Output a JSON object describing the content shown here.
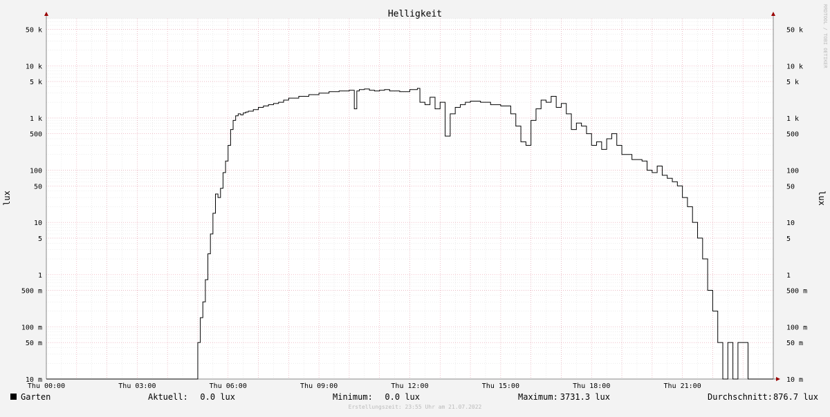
{
  "chart_data": {
    "type": "line",
    "title": "Helligkeit",
    "ylabel": "lux",
    "yscale": "log",
    "ylim": [
      0.01,
      80000
    ],
    "xlim": [
      "Thu 00:00",
      "Thu 24:00"
    ],
    "y_ticks": [
      {
        "value": 0.01,
        "label": "10 m"
      },
      {
        "value": 0.05,
        "label": "50 m"
      },
      {
        "value": 0.1,
        "label": "100 m"
      },
      {
        "value": 0.5,
        "label": "500 m"
      },
      {
        "value": 1,
        "label": "1"
      },
      {
        "value": 5,
        "label": "5"
      },
      {
        "value": 10,
        "label": "10"
      },
      {
        "value": 50,
        "label": "50"
      },
      {
        "value": 100,
        "label": "100"
      },
      {
        "value": 500,
        "label": "500"
      },
      {
        "value": 1000,
        "label": "1 k"
      },
      {
        "value": 5000,
        "label": "5 k"
      },
      {
        "value": 10000,
        "label": "10 k"
      },
      {
        "value": 50000,
        "label": "50 k"
      }
    ],
    "x_ticks": [
      {
        "value": "Thu 00:00",
        "label": "Thu 00:00"
      },
      {
        "value": "Thu 03:00",
        "label": "Thu 03:00"
      },
      {
        "value": "Thu 06:00",
        "label": "Thu 06:00"
      },
      {
        "value": "Thu 09:00",
        "label": "Thu 09:00"
      },
      {
        "value": "Thu 12:00",
        "label": "Thu 12:00"
      },
      {
        "value": "Thu 15:00",
        "label": "Thu 15:00"
      },
      {
        "value": "Thu 18:00",
        "label": "Thu 18:00"
      },
      {
        "value": "Thu 21:00",
        "label": "Thu 21:00"
      }
    ],
    "grid": true,
    "side_label": "RRDTOOL / TOBI OETIKER",
    "series": [
      {
        "name": "Garten",
        "color": "#000000",
        "x": [
          "00:00",
          "04:50",
          "05:00",
          "05:05",
          "05:10",
          "05:15",
          "05:20",
          "05:25",
          "05:30",
          "05:35",
          "05:40",
          "05:45",
          "05:50",
          "05:55",
          "06:00",
          "06:05",
          "06:10",
          "06:15",
          "06:20",
          "06:25",
          "06:30",
          "06:35",
          "06:40",
          "06:50",
          "07:00",
          "07:10",
          "07:20",
          "07:30",
          "07:40",
          "07:50",
          "08:00",
          "08:20",
          "08:40",
          "09:00",
          "09:20",
          "09:40",
          "10:00",
          "10:10",
          "10:15",
          "10:20",
          "10:30",
          "10:40",
          "10:50",
          "11:00",
          "11:10",
          "11:20",
          "11:40",
          "12:00",
          "12:15",
          "12:20",
          "12:30",
          "12:40",
          "12:50",
          "13:00",
          "13:10",
          "13:20",
          "13:30",
          "13:40",
          "13:50",
          "14:00",
          "14:20",
          "14:40",
          "15:00",
          "15:20",
          "15:30",
          "15:40",
          "15:50",
          "16:00",
          "16:10",
          "16:20",
          "16:30",
          "16:40",
          "16:50",
          "17:00",
          "17:10",
          "17:20",
          "17:30",
          "17:40",
          "17:50",
          "18:00",
          "18:10",
          "18:20",
          "18:30",
          "18:40",
          "18:50",
          "19:00",
          "19:20",
          "19:40",
          "19:50",
          "20:00",
          "20:10",
          "20:20",
          "20:30",
          "20:40",
          "20:50",
          "21:00",
          "21:10",
          "21:20",
          "21:30",
          "21:40",
          "21:50",
          "22:00",
          "22:10",
          "22:20",
          "22:30",
          "22:40",
          "22:50",
          "23:00",
          "23:10",
          "23:20",
          "23:40"
        ],
        "values": [
          0.01,
          0.01,
          0.05,
          0.15,
          0.3,
          0.8,
          2.5,
          6,
          15,
          35,
          30,
          45,
          90,
          150,
          300,
          600,
          900,
          1100,
          1200,
          1150,
          1250,
          1300,
          1350,
          1450,
          1600,
          1700,
          1800,
          1900,
          2000,
          2200,
          2400,
          2600,
          2800,
          3000,
          3200,
          3300,
          3400,
          1500,
          3300,
          3500,
          3600,
          3400,
          3300,
          3400,
          3500,
          3300,
          3200,
          3500,
          3700,
          2000,
          1800,
          2500,
          1500,
          2000,
          450,
          1200,
          1600,
          1800,
          2000,
          2100,
          2000,
          1800,
          1700,
          1200,
          700,
          350,
          300,
          900,
          1500,
          2200,
          2000,
          2600,
          1600,
          1900,
          1200,
          600,
          800,
          700,
          500,
          300,
          350,
          250,
          400,
          500,
          300,
          200,
          160,
          150,
          100,
          90,
          120,
          80,
          70,
          60,
          50,
          30,
          20,
          10,
          5,
          2,
          0.5,
          0.2,
          0.05,
          0.01,
          0.05,
          0.01,
          0.05,
          0.05,
          0.01,
          0.01,
          0.01
        ]
      }
    ]
  },
  "legend": {
    "series_name": "Garten",
    "swatch_color": "#000000",
    "current_label": "Aktuell:",
    "current_value": "0.0 lux",
    "min_label": "Minimum:",
    "min_value": "0.0 lux",
    "max_label": "Maximum:",
    "max_value": "3731.3 lux",
    "avg_label": "Durchschnitt:",
    "avg_value": "876.7 lux"
  },
  "footer": "Erstellungszeit: 23:55 Uhr am 21.07.2022",
  "colors": {
    "background": "#f3f3f3",
    "canvas": "#ffffff",
    "major_grid": "#e89aaa",
    "minor_grid": "#d8d8d8",
    "axis": "#888888",
    "arrow": "#990000"
  }
}
